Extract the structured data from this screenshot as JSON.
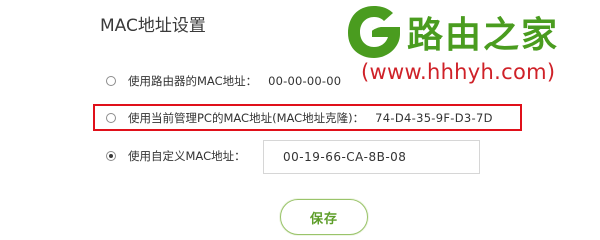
{
  "page": {
    "title": "MAC地址设置"
  },
  "options": [
    {
      "label": "使用路由器的MAC地址：",
      "value": "00-00-00-00",
      "selected": false
    },
    {
      "label": "使用当前管理PC的MAC地址(MAC地址克隆)：",
      "value": "74-D4-35-9F-D3-7D",
      "selected": false
    },
    {
      "label": "使用自定义MAC地址：",
      "value": "00-19-66-CA-8B-08",
      "selected": true
    }
  ],
  "save_button": {
    "label": "保存"
  },
  "watermark": {
    "brand": "路由之家",
    "url": "(www.hhhyh.com)"
  },
  "colors": {
    "highlight": "#e0101a",
    "brand_green": "#4a9c1f",
    "brand_red": "#cf2128",
    "save_text": "#5e9e2a"
  }
}
